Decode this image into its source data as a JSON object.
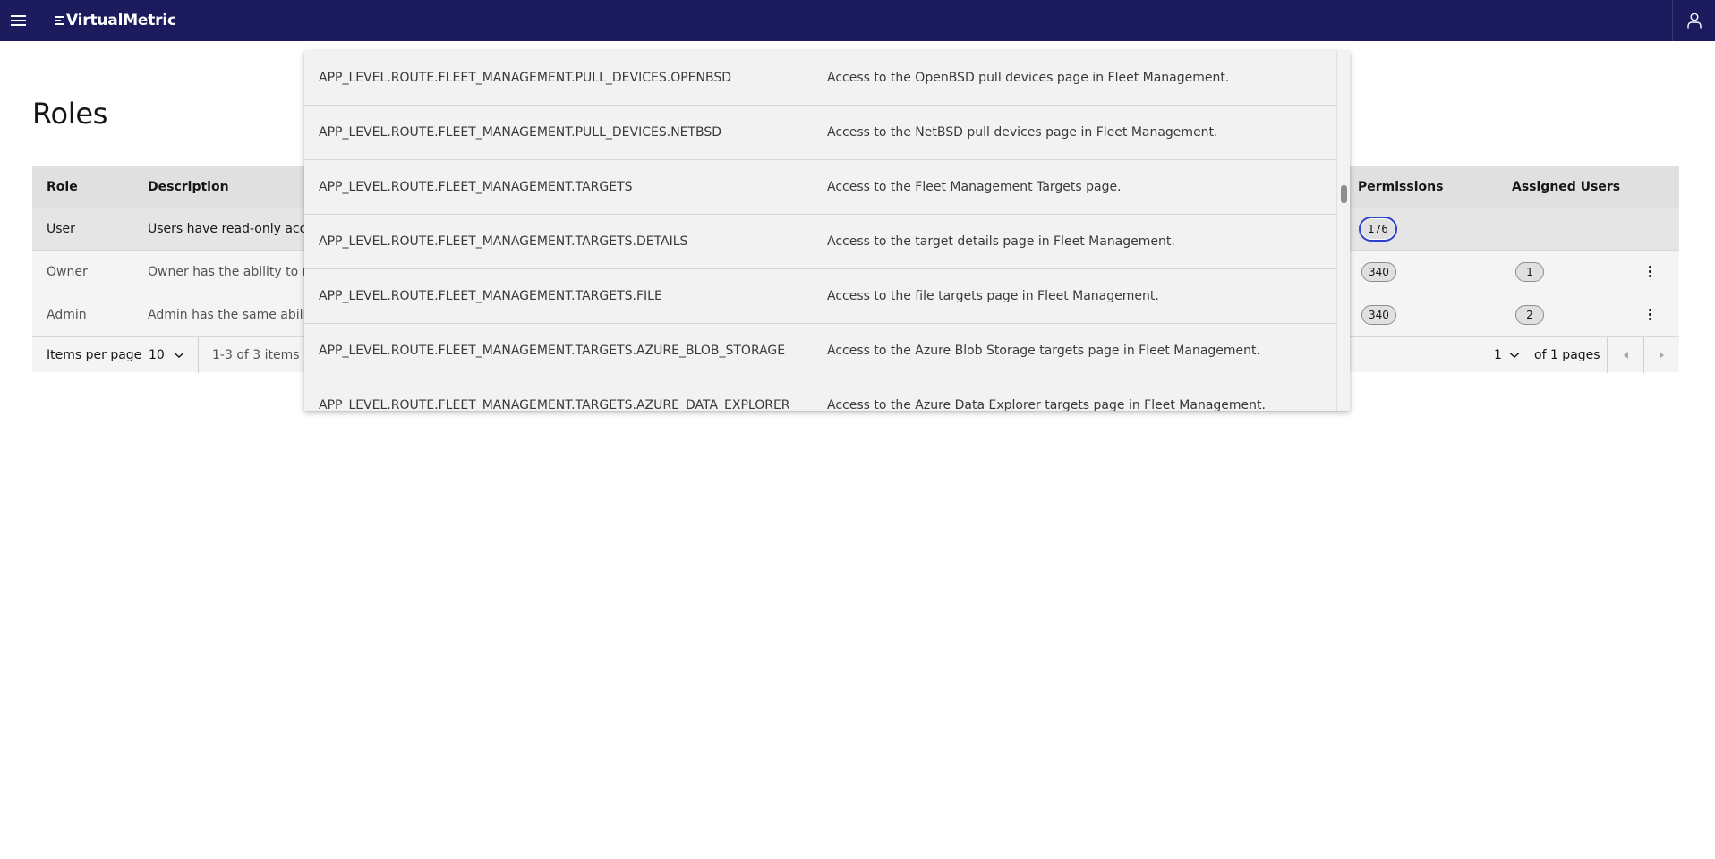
{
  "header": {
    "app_name": "VirtualMetric"
  },
  "page": {
    "title": "Roles"
  },
  "table": {
    "columns": {
      "role": "Role",
      "description": "Description",
      "permissions": "Permissions",
      "assigned_users": "Assigned Users"
    },
    "rows": [
      {
        "role": "User",
        "description": "Users have read-only acces",
        "permissions": "176",
        "assigned_users": ""
      },
      {
        "role": "Owner",
        "description": "Owner has the ability to rea",
        "permissions": "340",
        "assigned_users": "1"
      },
      {
        "role": "Admin",
        "description": "Admin has the same abilitie",
        "permissions": "340",
        "assigned_users": "2"
      }
    ]
  },
  "pagination": {
    "items_per_page_label": "Items per page",
    "items_per_page_value": "10",
    "range_text": "1-3 of 3 items",
    "page_value": "1",
    "of_pages": "of 1 pages"
  },
  "permissions_popover": {
    "rows": [
      {
        "permission": "APP_LEVEL.ROUTE.FLEET_MANAGEMENT.PULL_DEVICES.OPENBSD",
        "description": "Access to the OpenBSD pull devices page in Fleet Management."
      },
      {
        "permission": "APP_LEVEL.ROUTE.FLEET_MANAGEMENT.PULL_DEVICES.NETBSD",
        "description": "Access to the NetBSD pull devices page in Fleet Management."
      },
      {
        "permission": "APP_LEVEL.ROUTE.FLEET_MANAGEMENT.TARGETS",
        "description": "Access to the Fleet Management Targets page."
      },
      {
        "permission": "APP_LEVEL.ROUTE.FLEET_MANAGEMENT.TARGETS.DETAILS",
        "description": "Access to the target details page in Fleet Management."
      },
      {
        "permission": "APP_LEVEL.ROUTE.FLEET_MANAGEMENT.TARGETS.FILE",
        "description": "Access to the file targets page in Fleet Management."
      },
      {
        "permission": "APP_LEVEL.ROUTE.FLEET_MANAGEMENT.TARGETS.AZURE_BLOB_STORAGE",
        "description": "Access to the Azure Blob Storage targets page in Fleet Management."
      },
      {
        "permission": "APP_LEVEL.ROUTE.FLEET_MANAGEMENT.TARGETS.AZURE_DATA_EXPLORER",
        "description": "Access to the Azure Data Explorer targets page in Fleet Management."
      }
    ]
  },
  "colors": {
    "header_bg": "#1b1b5e",
    "focus_ring": "#3040d0",
    "table_header_bg": "#e0e0e0"
  }
}
